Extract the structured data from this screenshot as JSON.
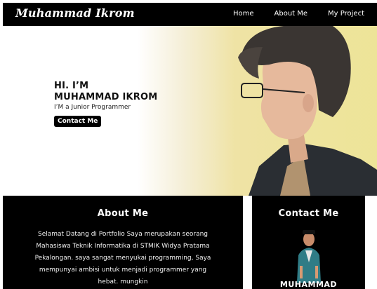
{
  "navbar": {
    "brand": "Muhammad Ikrom",
    "links": [
      "Home",
      "About Me",
      "My Project"
    ]
  },
  "hero": {
    "greeting": "HI. I’M",
    "name": "MUHAMMAD IKROM",
    "subtitle": "I’M a Junior Programmer",
    "button_label": "Contact Me"
  },
  "about": {
    "title": "About Me",
    "text": "Selamat Datang di Portfolio Saya merupakan seorang Mahasiswa Teknik Informatika di STMIK Widya Pratama Pekalongan.  saya sangat menyukai programming, Saya mempunyai ambisi untuk menjadi  programmer yang hebat. mungkin"
  },
  "contact": {
    "title": "Contact Me",
    "name": "MUHAMMAD"
  },
  "colors": {
    "nav_bg": "#000000",
    "hero_accent": "#ede49a",
    "section_bg": "#000000"
  }
}
